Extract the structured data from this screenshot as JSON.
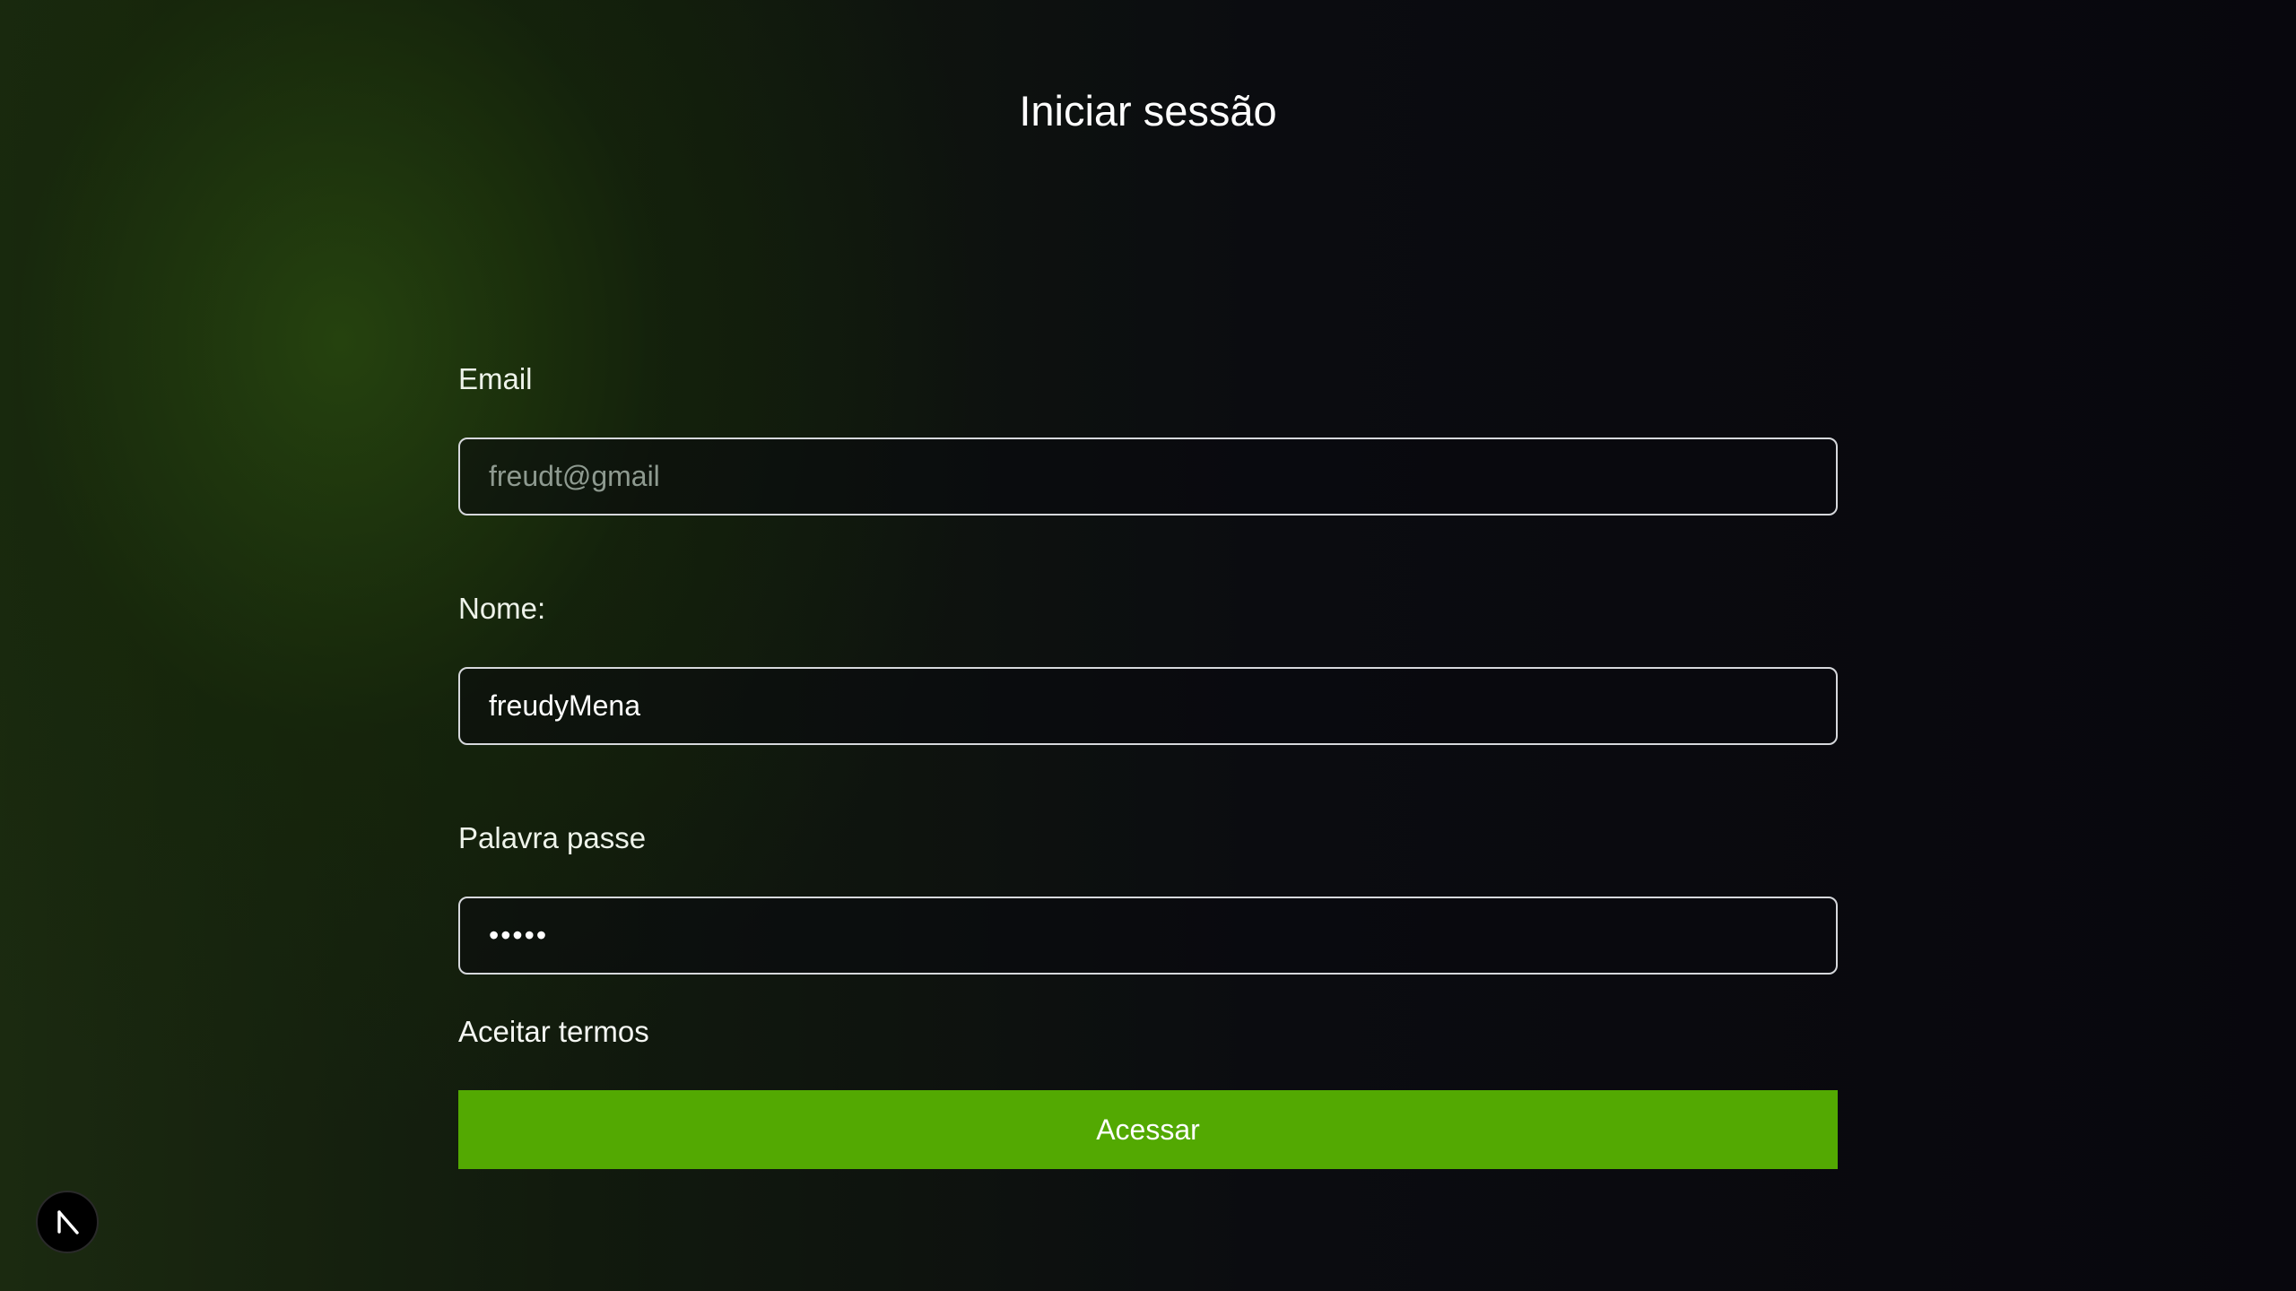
{
  "page": {
    "title": "Iniciar sessão"
  },
  "form": {
    "email": {
      "label": "Email",
      "value": "",
      "placeholder": "freudt@gmail"
    },
    "name": {
      "label": "Nome:",
      "value": "freudyMena",
      "placeholder": ""
    },
    "password": {
      "label": "Palavra passe",
      "value": "•••••"
    },
    "terms_label": "Aceitar termos",
    "submit_label": "Acessar"
  },
  "colors": {
    "accent": "#53a902",
    "background_dark": "#08070d",
    "background_green": "#1b2a10"
  },
  "icons": {
    "dev_badge": "nextjs-logo-icon"
  }
}
